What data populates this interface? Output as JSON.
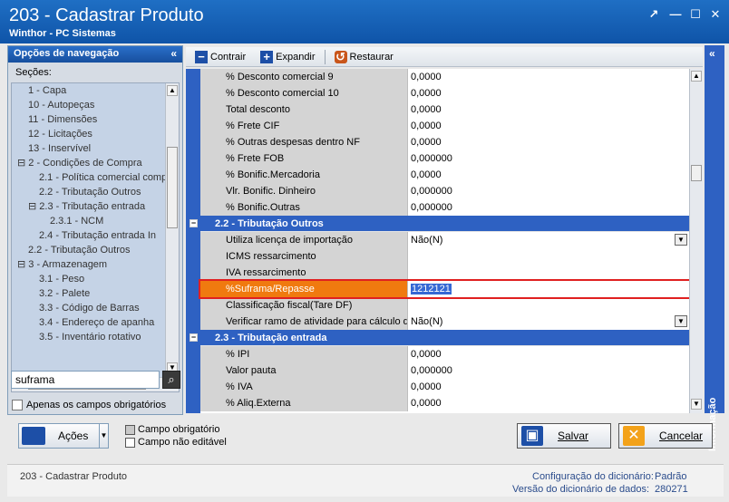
{
  "window": {
    "title": "203 - Cadastrar  Produto",
    "subtitle": "Winthor - PC Sistemas",
    "buttons": [
      "↗",
      "—",
      "☐",
      "✕"
    ]
  },
  "nav": {
    "header": "Opções de navegação",
    "collapse_glyph": "«",
    "sections_label": "Seções:",
    "tree": [
      {
        "label": "1 - Capa",
        "indent": 1
      },
      {
        "label": "10 - Autopeças",
        "indent": 1
      },
      {
        "label": "11 - Dimensões",
        "indent": 1
      },
      {
        "label": "12 - Licitações",
        "indent": 1
      },
      {
        "label": "13 - Inservível",
        "indent": 1
      },
      {
        "label": "⊟ 2 - Condições de Compra",
        "indent": 0
      },
      {
        "label": "2.1 - Política comercial comp",
        "indent": 2
      },
      {
        "label": "2.2 - Tributação Outros",
        "indent": 2
      },
      {
        "label": "⊟ 2.3 - Tributação entrada",
        "indent": 1
      },
      {
        "label": "2.3.1 - NCM",
        "indent": 3
      },
      {
        "label": "2.4 - Tributação entrada In",
        "indent": 2
      },
      {
        "label": "2.2 - Tributação Outros",
        "indent": 1
      },
      {
        "label": "⊟ 3 - Armazenagem",
        "indent": 0
      },
      {
        "label": "3.1 - Peso",
        "indent": 2
      },
      {
        "label": "3.2 - Palete",
        "indent": 2
      },
      {
        "label": "3.3 - Código de Barras",
        "indent": 2
      },
      {
        "label": "3.4 - Endereço de apanha",
        "indent": 2
      },
      {
        "label": "3.5 - Inventário rotativo",
        "indent": 2
      }
    ],
    "search_value": "suframa",
    "only_required_label": "Apenas os campos obrigatórios"
  },
  "toolbar": {
    "contrair": "Contrair",
    "expandir": "Expandir",
    "restaurar": "Restaurar"
  },
  "grid": {
    "rows": [
      {
        "type": "field",
        "label": "% Desconto comercial 9",
        "value": "0,0000"
      },
      {
        "type": "field",
        "label": "% Desconto comercial 10",
        "value": "0,0000"
      },
      {
        "type": "field",
        "label": "Total desconto",
        "value": "0,0000"
      },
      {
        "type": "field",
        "label": "% Frete CIF",
        "value": "0,0000"
      },
      {
        "type": "field",
        "label": "% Outras despesas dentro NF",
        "value": "0,0000"
      },
      {
        "type": "field",
        "label": "% Frete FOB",
        "value": "0,000000"
      },
      {
        "type": "field",
        "label": "% Bonific.Mercadoria",
        "value": "0,0000"
      },
      {
        "type": "field",
        "label": "Vlr. Bonific. Dinheiro",
        "value": "0,000000"
      },
      {
        "type": "field",
        "label": "% Bonific.Outras",
        "value": "0,000000"
      },
      {
        "type": "section",
        "label": "2.2 - Tributação Outros"
      },
      {
        "type": "field",
        "label": "Utiliza licença de importação",
        "value": "Não(N)",
        "dropdown": true
      },
      {
        "type": "field",
        "label": "ICMS ressarcimento",
        "value": ""
      },
      {
        "type": "field",
        "label": "IVA ressarcimento",
        "value": ""
      },
      {
        "type": "field",
        "label": "%Suframa/Repasse",
        "value": "1212121",
        "highlight": true
      },
      {
        "type": "field",
        "label": "Classificação fiscal(Tare DF)",
        "value": ""
      },
      {
        "type": "field",
        "label": "Verificar ramo de atividade para cálculo do",
        "value": "Não(N)",
        "dropdown": true
      },
      {
        "type": "section",
        "label": "2.3 - Tributação entrada"
      },
      {
        "type": "field",
        "label": "% IPI",
        "value": "0,0000"
      },
      {
        "type": "field",
        "label": "Valor pauta",
        "value": "0,000000"
      },
      {
        "type": "field",
        "label": "% IVA",
        "value": "0,0000"
      },
      {
        "type": "field",
        "label": "% Aliq.Externa",
        "value": "0,0000"
      }
    ]
  },
  "info_tab": {
    "label": "Informação",
    "arrow": "«"
  },
  "actions": {
    "acoes": "Ações",
    "legend_required": "Campo obrigatório",
    "legend_noneditable": "Campo não editável",
    "salvar": "Salvar",
    "cancelar": "Cancelar"
  },
  "status": {
    "routine": "203 - Cadastrar  Produto",
    "dict_config_label": "Configuração do dicionário:",
    "dict_config_value": "Padrão",
    "dict_version_label": "Versão do dicionário de dados:",
    "dict_version_value": "280271"
  },
  "colors": {
    "title_blue": "#1f6fc4",
    "section_blue": "#2e61c2",
    "highlight_orange": "#f07a0f",
    "highlight_border": "#e02020"
  }
}
